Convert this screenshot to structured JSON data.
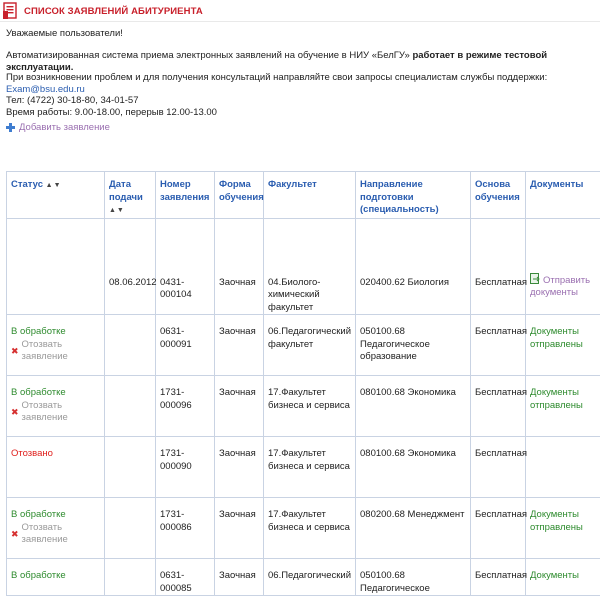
{
  "header": {
    "title": "СПИСОК ЗАЯВЛЕНИЙ АБИТУРИЕНТА"
  },
  "intro": {
    "greeting": "Уважаемые пользователи!",
    "line1_text": "Автоматизированная система приема электронных заявлений на обучение в НИУ «БелГУ» ",
    "line1_bold": "работает в режиме тестовой эксплуатации.",
    "support": "При возникновении проблем и для получения консультаций направляйте свои запросы специалистам службы поддержки:",
    "email": "Exam@bsu.edu.ru",
    "phone": "Тел: (4722) 30-18-80, 34-01-57",
    "hours": "Время работы: 9.00-18.00, перерыв 12.00-13.00"
  },
  "add_application": "Добавить заявление",
  "table": {
    "headers": {
      "status": "Статус",
      "date": "Дата подачи",
      "number": "Номер заявления",
      "form": "Форма обучения",
      "faculty": "Факультет",
      "direction": "Направление подготовки (специальность)",
      "basis": "Основа обучения",
      "documents": "Документы"
    },
    "sort_arrows": "▲▼",
    "rows": [
      {
        "status": "",
        "revoke": "",
        "date": "08.06.2012",
        "number": "0431-000104",
        "form": "Заочная",
        "faculty": "04.Биолого-химический факультет",
        "direction": "020400.62 Биология",
        "basis": "Бесплатная",
        "documents": "Отправить документы"
      },
      {
        "status": "В обработке",
        "revoke": "Отозвать заявление",
        "date": "",
        "number": "0631-000091",
        "form": "Заочная",
        "faculty": "06.Педагогический факультет",
        "direction": "050100.68 Педагогическое образование",
        "basis": "Бесплатная",
        "documents": "Документы отправлены"
      },
      {
        "status": "В обработке",
        "revoke": "Отозвать заявление",
        "date": "",
        "number": "1731-000096",
        "form": "Заочная",
        "faculty": "17.Факультет бизнеса и сервиса",
        "direction": "080100.68 Экономика",
        "basis": "Бесплатная",
        "documents": "Документы отправлены"
      },
      {
        "status": "Отозвано",
        "revoke": "",
        "date": "",
        "number": "1731-000090",
        "form": "Заочная",
        "faculty": "17.Факультет бизнеса и сервиса",
        "direction": "080100.68 Экономика",
        "basis": "Бесплатная",
        "documents": ""
      },
      {
        "status": "В обработке",
        "revoke": "Отозвать заявление",
        "date": "",
        "number": "1731-000086",
        "form": "Заочная",
        "faculty": "17.Факультет бизнеса и сервиса",
        "direction": "080200.68 Менеджмент",
        "basis": "Бесплатная",
        "documents": "Документы отправлены"
      },
      {
        "status": "В обработке",
        "revoke": "",
        "date": "",
        "number": "0631-000085",
        "form": "Заочная",
        "faculty": "06.Педагогический",
        "direction": "050100.68 Педагогическое",
        "basis": "Бесплатная",
        "documents": "Документы"
      }
    ]
  },
  "colors": {
    "title_red": "#c8202b",
    "link_blue": "#2a5db0",
    "status_green": "#2e8b2e",
    "status_red": "#e0201d",
    "purple_link": "#9a6fb0"
  }
}
